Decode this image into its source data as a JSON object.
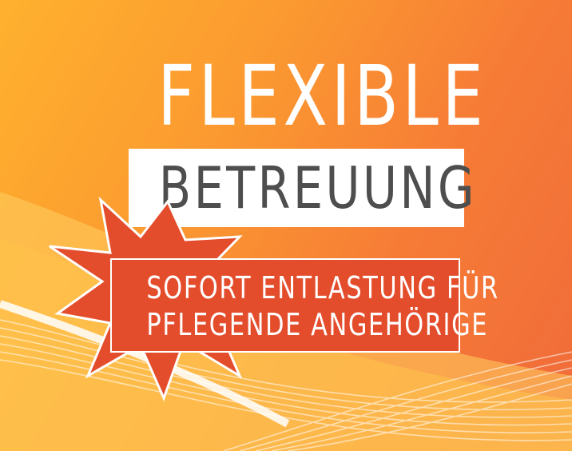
{
  "poster": {
    "headline": "FLEXIBLE",
    "subheadline": "BETREUUNG",
    "tagline_line_1": "SOFORT ENTLASTUNG FÜR",
    "tagline_line_2": "PFLEGENDE ANGEHÖRIGE"
  },
  "colors": {
    "background_start": "#ffb12e",
    "background_end": "#f06a3a",
    "burst_red": "#e44d2c",
    "headline_white": "#ffffff",
    "subheadline_grey": "#4e4e4e"
  }
}
